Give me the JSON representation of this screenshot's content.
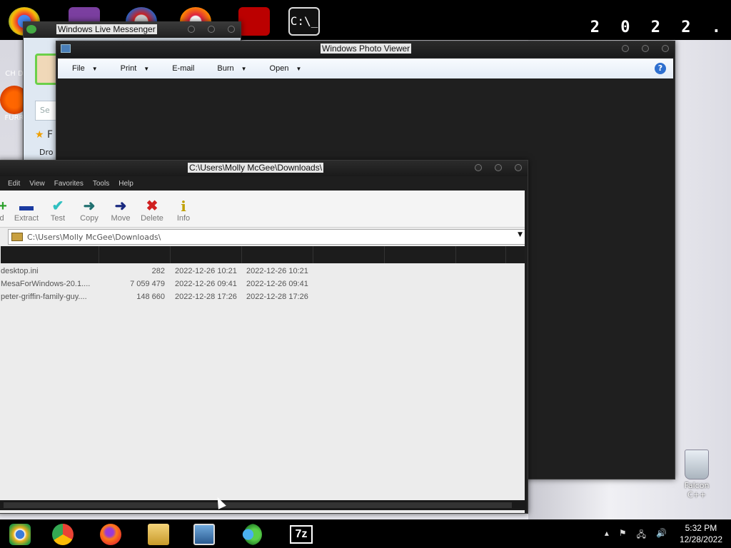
{
  "desktop": {
    "date_banner": "2 0 2 2 .",
    "icons": [
      {
        "label": "CH D",
        "icon": "chrome-icon"
      },
      {
        "label": "FURR",
        "icon": "firefox-icon"
      }
    ],
    "recycle_bin_label": "Falcon C++"
  },
  "messenger": {
    "title": "Windows Live Messenger",
    "search_placeholder": "Se",
    "favorites_label": "F",
    "drop_label": "Dro"
  },
  "photo_viewer": {
    "title": "Windows Photo Viewer",
    "menu": [
      "File",
      "Print",
      "E-mail",
      "Burn",
      "Open"
    ],
    "menu_has_arrow": [
      true,
      true,
      false,
      true,
      true
    ],
    "help": "?"
  },
  "sevenzip": {
    "title": "C:\\Users\\Molly McGee\\Downloads\\",
    "menu": [
      "Edit",
      "View",
      "Favorites",
      "Tools",
      "Help"
    ],
    "toolbar": [
      {
        "label": "ld",
        "icon": "add-icon",
        "glyph": "+",
        "color": "#2aa02a"
      },
      {
        "label": "Extract",
        "icon": "extract-icon",
        "glyph": "—",
        "color": "#1a3aa0"
      },
      {
        "label": "Test",
        "icon": "test-icon",
        "glyph": "✔",
        "color": "#30c0c0"
      },
      {
        "label": "Copy",
        "icon": "copy-icon",
        "glyph": "➜",
        "color": "#207070"
      },
      {
        "label": "Move",
        "icon": "move-icon",
        "glyph": "➜",
        "color": "#1a2a80"
      },
      {
        "label": "Delete",
        "icon": "delete-icon",
        "glyph": "✖",
        "color": "#d02020"
      },
      {
        "label": "Info",
        "icon": "info-icon",
        "glyph": "i",
        "color": "#c0a000"
      }
    ],
    "address": "C:\\Users\\Molly McGee\\Downloads\\",
    "files": [
      {
        "name": "desktop.ini",
        "size": "282",
        "modified": "2022-12-26 10:21",
        "created": "2022-12-26 10:21"
      },
      {
        "name": "MesaForWindows-20.1....",
        "size": "7 059 479",
        "modified": "2022-12-26 09:41",
        "created": "2022-12-26 09:41"
      },
      {
        "name": "peter-griffin-family-guy....",
        "size": "148 660",
        "modified": "2022-12-28 17:26",
        "created": "2022-12-28 17:26"
      }
    ]
  },
  "taskbar": {
    "apps": [
      "chrome-alt-icon",
      "chrome-icon",
      "firefox-icon",
      "file-explorer-icon",
      "photo-viewer-icon",
      "messenger-icon",
      "sevenzip-icon"
    ],
    "sevenzip_label": "7z",
    "time": "5:32 PM",
    "date": "12/28/2022"
  }
}
